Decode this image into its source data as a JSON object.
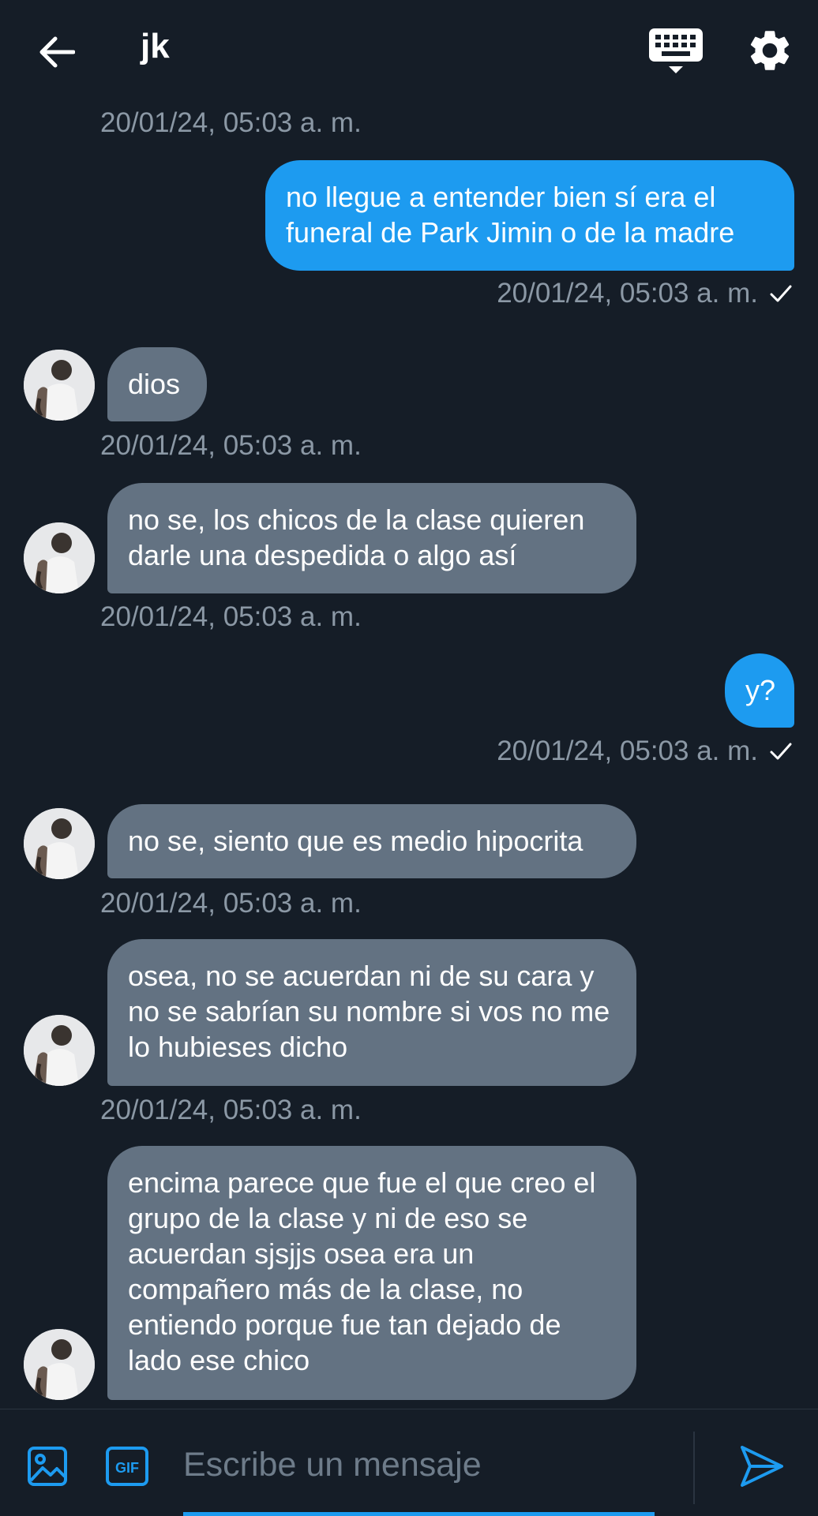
{
  "header": {
    "title": "jk",
    "icons": {
      "back": "arrow-left-icon",
      "keyboard": "keyboard-icon",
      "settings": "gear-icon"
    }
  },
  "messages": [
    {
      "direction": "timestamp",
      "time": "20/01/24, 05:03 a. m."
    },
    {
      "direction": "out",
      "text": "no llegue a entender bien sí era el funeral de Park Jimin o de la madre",
      "time": "20/01/24, 05:03 a. m.",
      "status": "sent"
    },
    {
      "direction": "in",
      "text": "dios",
      "time": "20/01/24, 05:03 a. m."
    },
    {
      "direction": "in",
      "text": "no se, los chicos de la clase quieren darle una despedida o algo así",
      "time": "20/01/24, 05:03 a. m."
    },
    {
      "direction": "out",
      "text": "y?",
      "time": "20/01/24, 05:03 a. m.",
      "status": "sent"
    },
    {
      "direction": "in",
      "text": "no se, siento que es medio hipocrita",
      "time": "20/01/24, 05:03 a. m."
    },
    {
      "direction": "in",
      "text": "osea, no se acuerdan ni de su cara y no se sabrían su nombre si vos no me lo hubieses dicho",
      "time": "20/01/24, 05:03 a. m."
    },
    {
      "direction": "in",
      "text": "encima parece que fue el que creo el grupo de la clase y ni de eso se acuerdan sjsjjs osea era un compañero más de la clase, no entiendo porque fue tan dejado de lado ese chico"
    }
  ],
  "composer": {
    "placeholder": "Escribe un mensaje",
    "gif_label": "GIF",
    "icons": {
      "image": "image-icon",
      "gif": "gif-icon",
      "send": "send-icon"
    }
  },
  "colors": {
    "background": "#151d27",
    "outgoing_bubble": "#1d9bf0",
    "incoming_bubble": "#637282",
    "timestamp": "#8b98a5",
    "accent": "#1d9bf0"
  }
}
